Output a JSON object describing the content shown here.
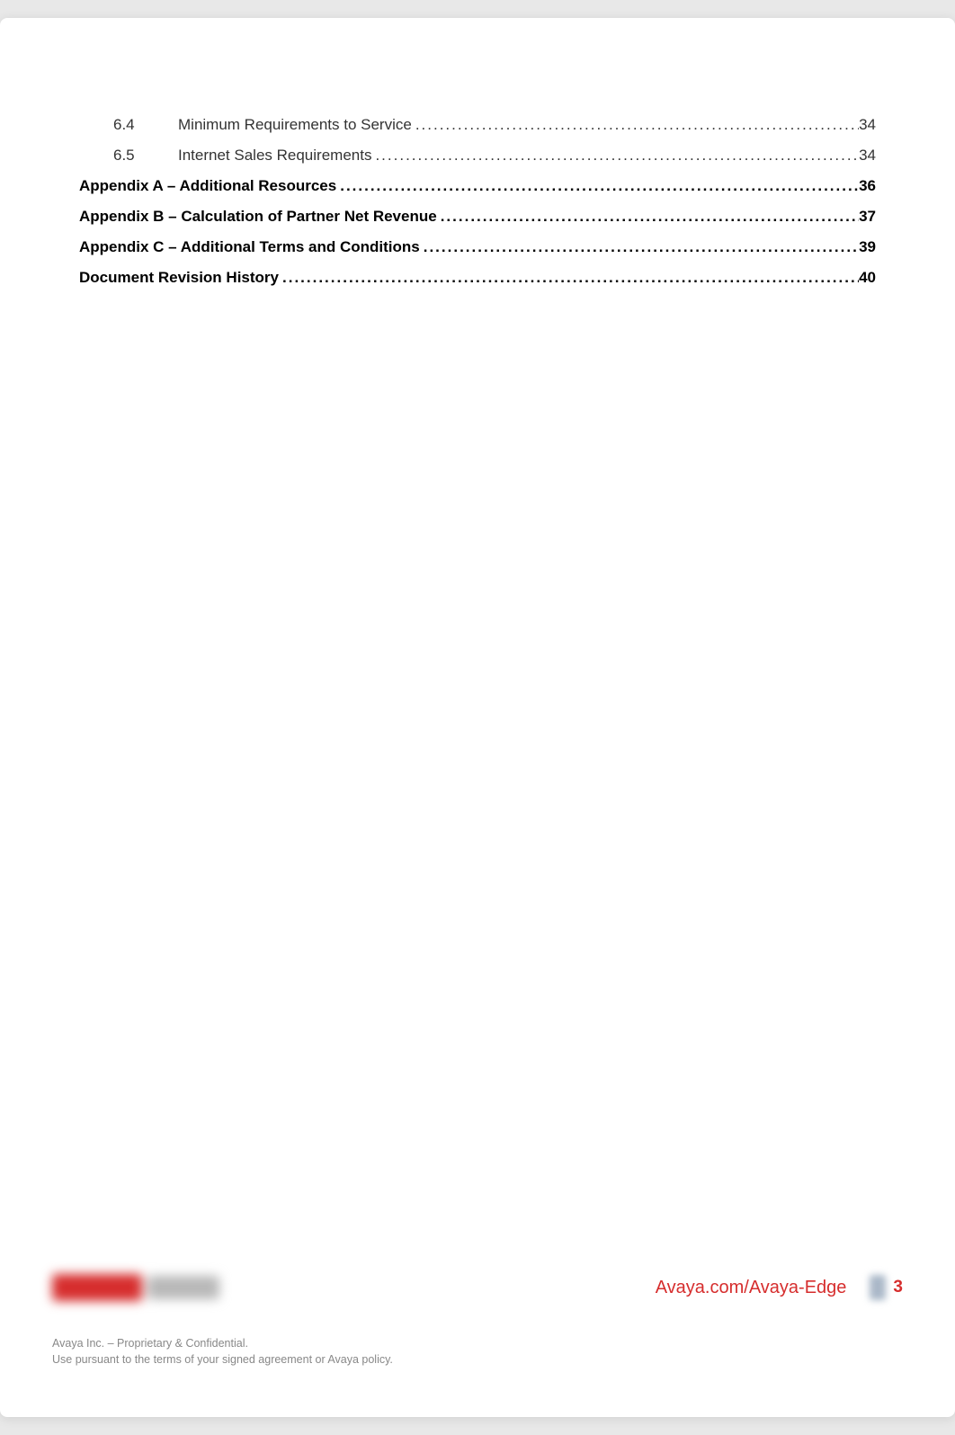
{
  "toc": {
    "entries": [
      {
        "number": "6.4",
        "title": "Minimum Requirements to Service",
        "page": "34",
        "bold": false,
        "indent": true
      },
      {
        "number": "6.5",
        "title": "Internet Sales Requirements",
        "page": "34",
        "bold": false,
        "indent": true
      },
      {
        "number": "",
        "title": "Appendix A – Additional Resources",
        "page": "36",
        "bold": true,
        "indent": false
      },
      {
        "number": "",
        "title": "Appendix B – Calculation of Partner Net Revenue",
        "page": "37",
        "bold": true,
        "indent": false
      },
      {
        "number": "",
        "title": "Appendix C – Additional Terms and Conditions",
        "page": "39",
        "bold": true,
        "indent": false
      },
      {
        "number": "",
        "title": "Document Revision History",
        "page": "40",
        "bold": true,
        "indent": false
      }
    ]
  },
  "footer": {
    "url": "Avaya.com/Avaya-Edge",
    "page_number": "3",
    "legal_line1": "Avaya Inc. – Proprietary & Confidential.",
    "legal_line2": "Use pursuant to the terms of your signed agreement or Avaya policy."
  }
}
